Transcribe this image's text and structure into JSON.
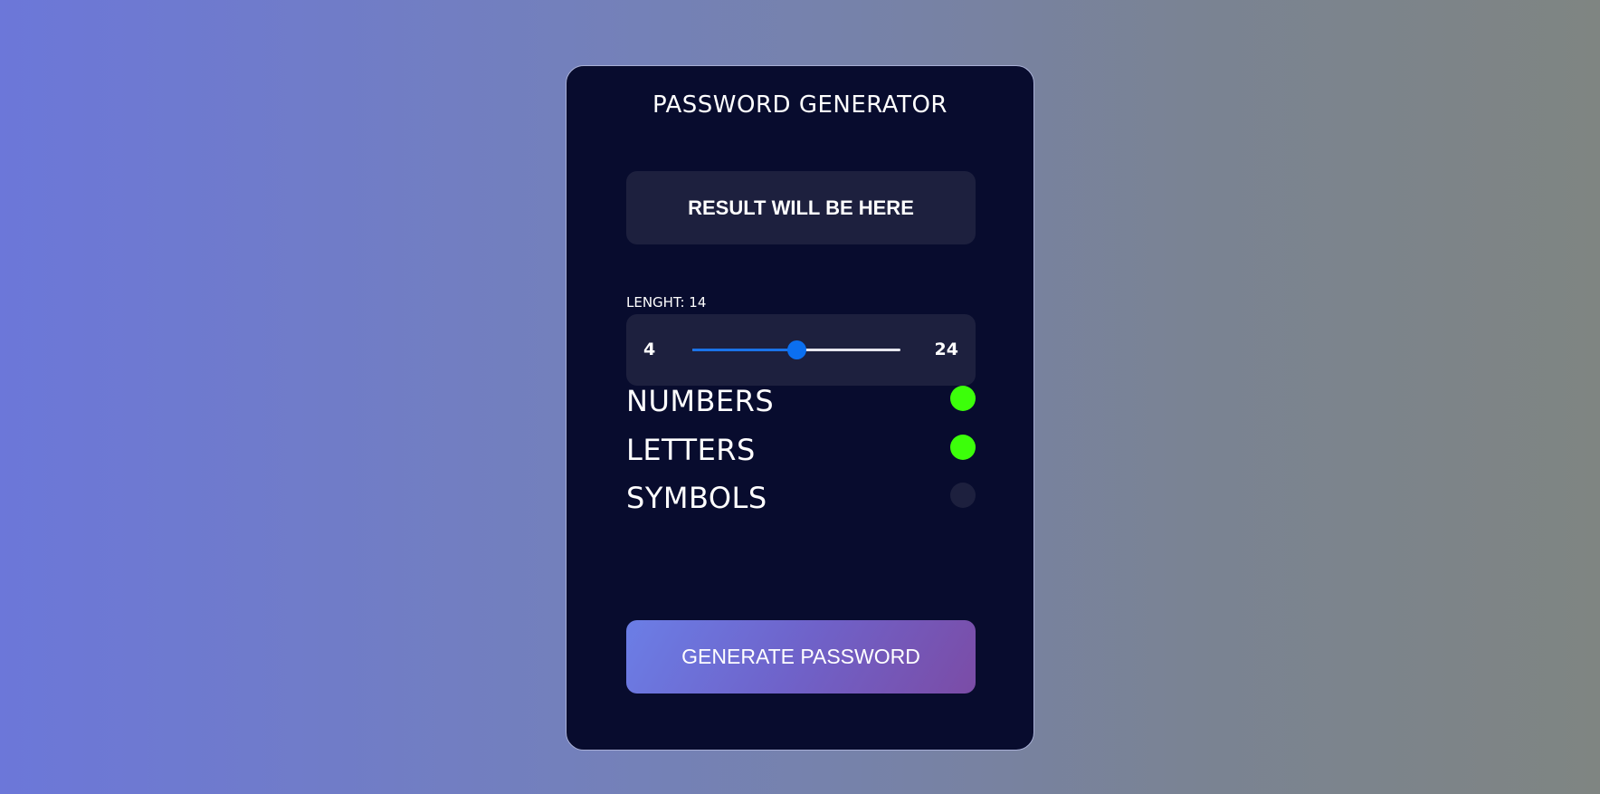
{
  "app": {
    "title": "PASSWORD GENERATOR"
  },
  "result": {
    "text": "RESULT WILL BE HERE"
  },
  "length": {
    "label": "LENGHT: 14",
    "min": "4",
    "max": "24",
    "value": 14,
    "min_value": 4,
    "max_value": 24
  },
  "options": [
    {
      "label": "NUMBERS",
      "enabled": true
    },
    {
      "label": "LETTERS",
      "enabled": true
    },
    {
      "label": "SYMBOLS",
      "enabled": false
    }
  ],
  "generate": {
    "label": "GENERATE PASSWORD"
  },
  "colors": {
    "card_background": "#080c2e",
    "panel_background": "#1d203e",
    "slider_accent": "#1a73e8",
    "toggle_on": "#3cff0a",
    "toggle_off": "#1d203e"
  }
}
